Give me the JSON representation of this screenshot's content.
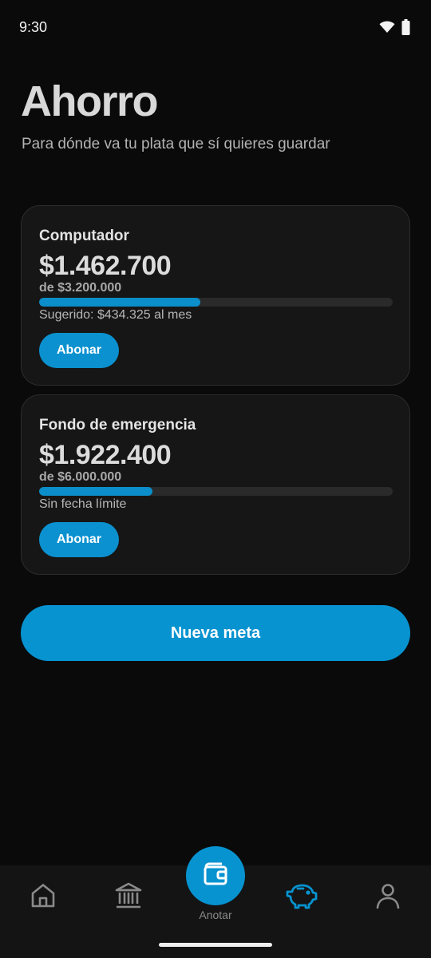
{
  "status_bar": {
    "time": "9:30"
  },
  "header": {
    "title": "Ahorro",
    "subtitle": "Para dónde va tu plata que sí quieres guardar"
  },
  "goals": [
    {
      "name": "Computador",
      "saved": "$1.462.700",
      "target": "de $3.200.000",
      "progress": 0.457,
      "note": "Sugerido: $434.325 al mes",
      "button": "Abonar"
    },
    {
      "name": "Fondo de emergencia",
      "saved": "$1.922.400",
      "target": "de $6.000.000",
      "progress": 0.32,
      "note": "Sin fecha límite",
      "button": "Abonar"
    }
  ],
  "new_goal_button": "Nueva meta",
  "bottom_nav": {
    "items": [
      "home-icon",
      "bank-icon",
      "wallet-icon",
      "piggy-bank-icon",
      "profile-icon"
    ],
    "fab_label": "Anotar",
    "active": "piggy-bank-icon"
  },
  "colors": {
    "accent": "#0793d0",
    "background": "#0a0a0a",
    "card": "#161616",
    "nav_inactive": "#8a8a8a"
  }
}
